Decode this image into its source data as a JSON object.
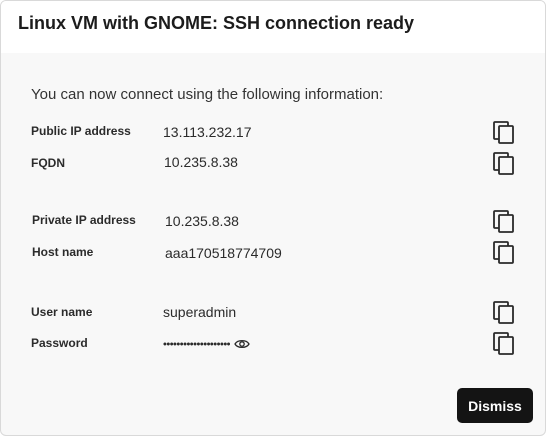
{
  "dialog": {
    "title": "Linux VM with GNOME: SSH connection ready",
    "intro": "You can now connect using the following information:",
    "rows": [
      {
        "label": "Public IP address",
        "value": "13.113.232.17"
      },
      {
        "label": "FQDN",
        "value": "10.235.8.38"
      },
      {
        "label": "Private IP address",
        "value": "10.235.8.38"
      },
      {
        "label": "Host name",
        "value": "aaa170518774709"
      },
      {
        "label": "User name",
        "value": "superadmin"
      },
      {
        "label": "Password",
        "value": "••••••••••••••••••••"
      }
    ],
    "copy_icon": "copy-icon",
    "reveal_icon": "eye-icon",
    "dismiss_label": "Dismiss"
  },
  "colors": {
    "dialog_background": "#f8f8f8",
    "header_background": "#ffffff",
    "primary_button": "#141414"
  }
}
